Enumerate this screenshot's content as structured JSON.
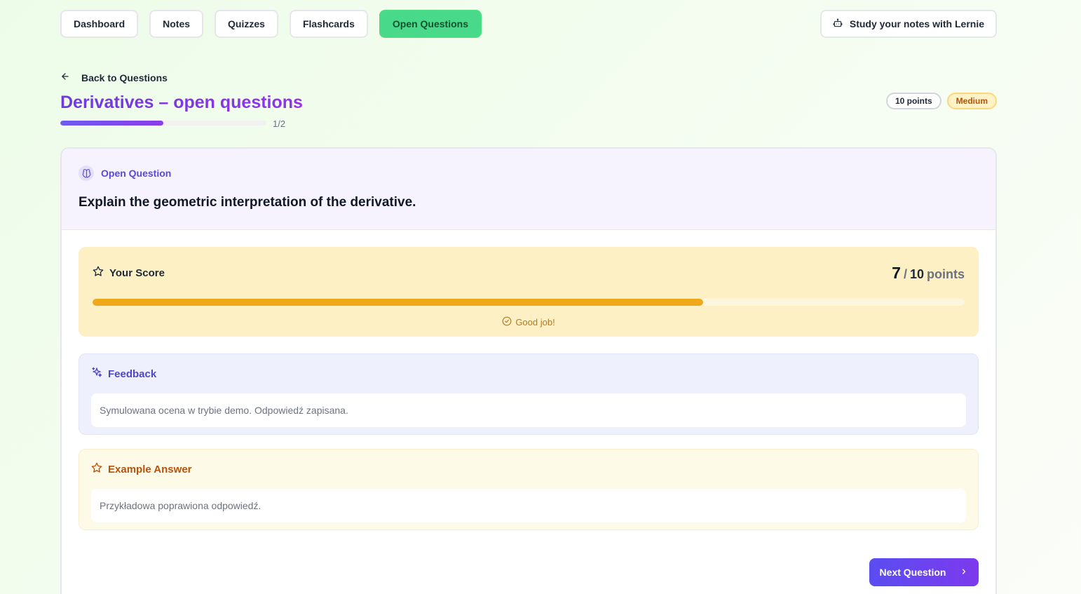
{
  "nav": {
    "items": [
      {
        "label": "Dashboard"
      },
      {
        "label": "Notes"
      },
      {
        "label": "Quizzes"
      },
      {
        "label": "Flashcards"
      },
      {
        "label": "Open Questions",
        "active": true
      }
    ],
    "lernie_label": "Study your notes with Lernie"
  },
  "header": {
    "back_label": "Back to Questions",
    "title": "Derivatives – open questions",
    "progress_text": "1/2",
    "progress_fraction": 0.5,
    "points_badge": "10 points",
    "difficulty_badge": "Medium"
  },
  "question": {
    "type_label": "Open Question",
    "text": "Explain the geometric interpretation of the derivative."
  },
  "score": {
    "title": "Your Score",
    "value": "7",
    "separator": "/",
    "max": "10",
    "unit": "points",
    "fraction": 0.7,
    "message": "Good job!"
  },
  "feedback": {
    "title": "Feedback",
    "text": "Symulowana ocena w trybie demo. Odpowiedź zapisana."
  },
  "example": {
    "title": "Example Answer",
    "text": "Przykładowa poprawiona odpowiedź."
  },
  "next_label": "Next Question",
  "colors": {
    "accent_purple": "#7c3aed",
    "active_nav": "#48d98a",
    "score_bar": "#f0a81a"
  }
}
